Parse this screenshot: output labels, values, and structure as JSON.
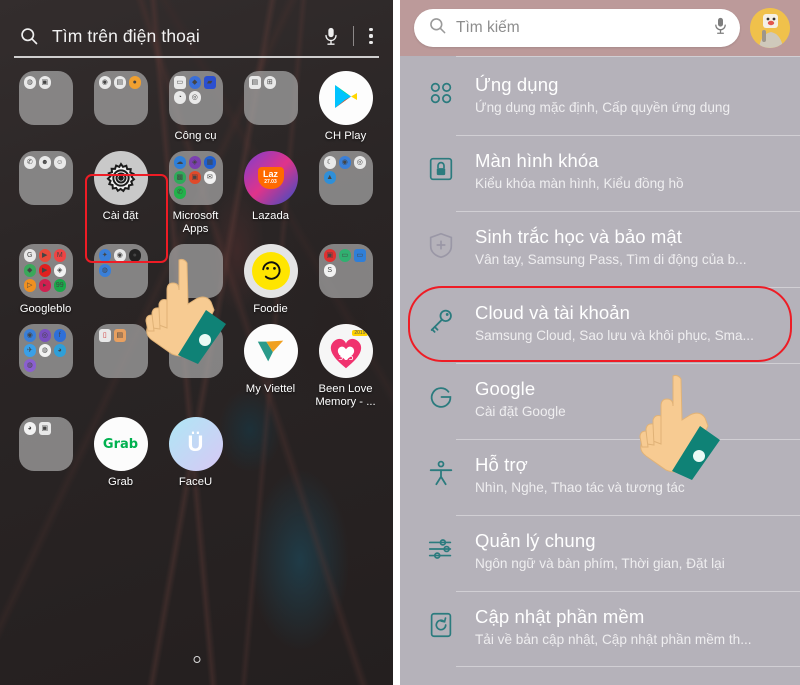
{
  "home": {
    "search": {
      "placeholder": "Tìm trên điện thoại",
      "search_icon": "search-icon",
      "mic_icon": "microphone-icon",
      "menu_icon": "more-options-icon"
    },
    "rows": [
      [
        {
          "label": "",
          "type": "folder",
          "minis": 2
        },
        {
          "label": "",
          "type": "folder",
          "minis": 3
        },
        {
          "label": "Công cụ",
          "type": "folder",
          "minis": 5
        },
        {
          "label": "",
          "type": "folder",
          "minis": 2
        },
        {
          "label": "CH Play",
          "type": "app",
          "icon": "play-store-icon"
        }
      ],
      [
        {
          "label": "",
          "type": "folder",
          "minis": 3
        },
        {
          "label": "Cài đặt",
          "type": "app",
          "icon": "settings-gear-icon"
        },
        {
          "label": "Microsoft Apps",
          "type": "folder",
          "minis": 7
        },
        {
          "label": "Lazada",
          "type": "app",
          "icon": "lazada-icon"
        },
        {
          "label": "",
          "type": "folder",
          "minis": 4
        }
      ],
      [
        {
          "label": "Googleblo",
          "type": "folder",
          "minis": 9
        },
        {
          "label": "",
          "type": "folder",
          "minis": 4
        },
        {
          "label": "",
          "type": "folder",
          "minis": 0
        },
        {
          "label": "Foodie",
          "type": "app",
          "icon": "foodie-icon"
        },
        {
          "label": "",
          "type": "folder",
          "minis": 4
        }
      ],
      [
        {
          "label": "",
          "type": "folder",
          "minis": 7
        },
        {
          "label": "",
          "type": "folder",
          "minis": 2
        },
        {
          "label": "",
          "type": "folder",
          "minis": 3
        },
        {
          "label": "My Viettel",
          "type": "app",
          "icon": "viettel-icon"
        },
        {
          "label": "Been Love Memory - ...",
          "type": "app",
          "icon": "been-love-heart-icon"
        }
      ],
      [
        {
          "label": "",
          "type": "folder",
          "minis": 2
        },
        {
          "label": "Grab",
          "type": "app",
          "icon": "grab-icon"
        },
        {
          "label": "FaceU",
          "type": "app",
          "icon": "faceu-icon"
        },
        {
          "label": "",
          "type": "empty"
        },
        {
          "label": "",
          "type": "empty"
        }
      ]
    ],
    "highlight_label": "Cài đặt",
    "page_indicator": "page-dot"
  },
  "settings": {
    "search": {
      "placeholder": "Tìm kiếm",
      "search_icon": "search-icon",
      "mic_icon": "microphone-icon"
    },
    "avatar": "user-avatar",
    "items": [
      {
        "icon": "apps-grid-icon",
        "title": "Ứng dụng",
        "subtitle": "Ứng dụng mặc định, Cấp quyền ứng dụng"
      },
      {
        "icon": "lock-screen-icon",
        "title": "Màn hình khóa",
        "subtitle": "Kiểu khóa màn hình, Kiểu đồng hồ"
      },
      {
        "icon": "shield-plus-icon",
        "title": "Sinh trắc học và bảo mật",
        "subtitle": "Vân tay, Samsung Pass, Tìm di động của b..."
      },
      {
        "icon": "key-icon",
        "title": "Cloud và tài khoản",
        "subtitle": "Samsung Cloud, Sao lưu và khôi phục, Sma..."
      },
      {
        "icon": "google-g-icon",
        "title": "Google",
        "subtitle": "Cài đặt Google"
      },
      {
        "icon": "accessibility-icon",
        "title": "Hỗ trợ",
        "subtitle": "Nhìn, Nghe, Thao tác và tương tác"
      },
      {
        "icon": "sliders-icon",
        "title": "Quản lý chung",
        "subtitle": "Ngôn ngữ và bàn phím, Thời gian, Đặt lại"
      },
      {
        "icon": "software-update-icon",
        "title": "Cập nhật phần mềm",
        "subtitle": "Tải về bản cập nhật, Cập nhật phần mềm th..."
      }
    ],
    "highlighted_item": "Cloud và tài khoản"
  },
  "colors": {
    "highlight_red": "#ee1c25",
    "settings_header": "#bc9a9a",
    "settings_background": "#b5b2ba",
    "icon_teal": "#2b7b7e",
    "home_background": "#2b2727",
    "hand_skin": "#f5c98a",
    "hand_sleeve": "#0f8276"
  }
}
